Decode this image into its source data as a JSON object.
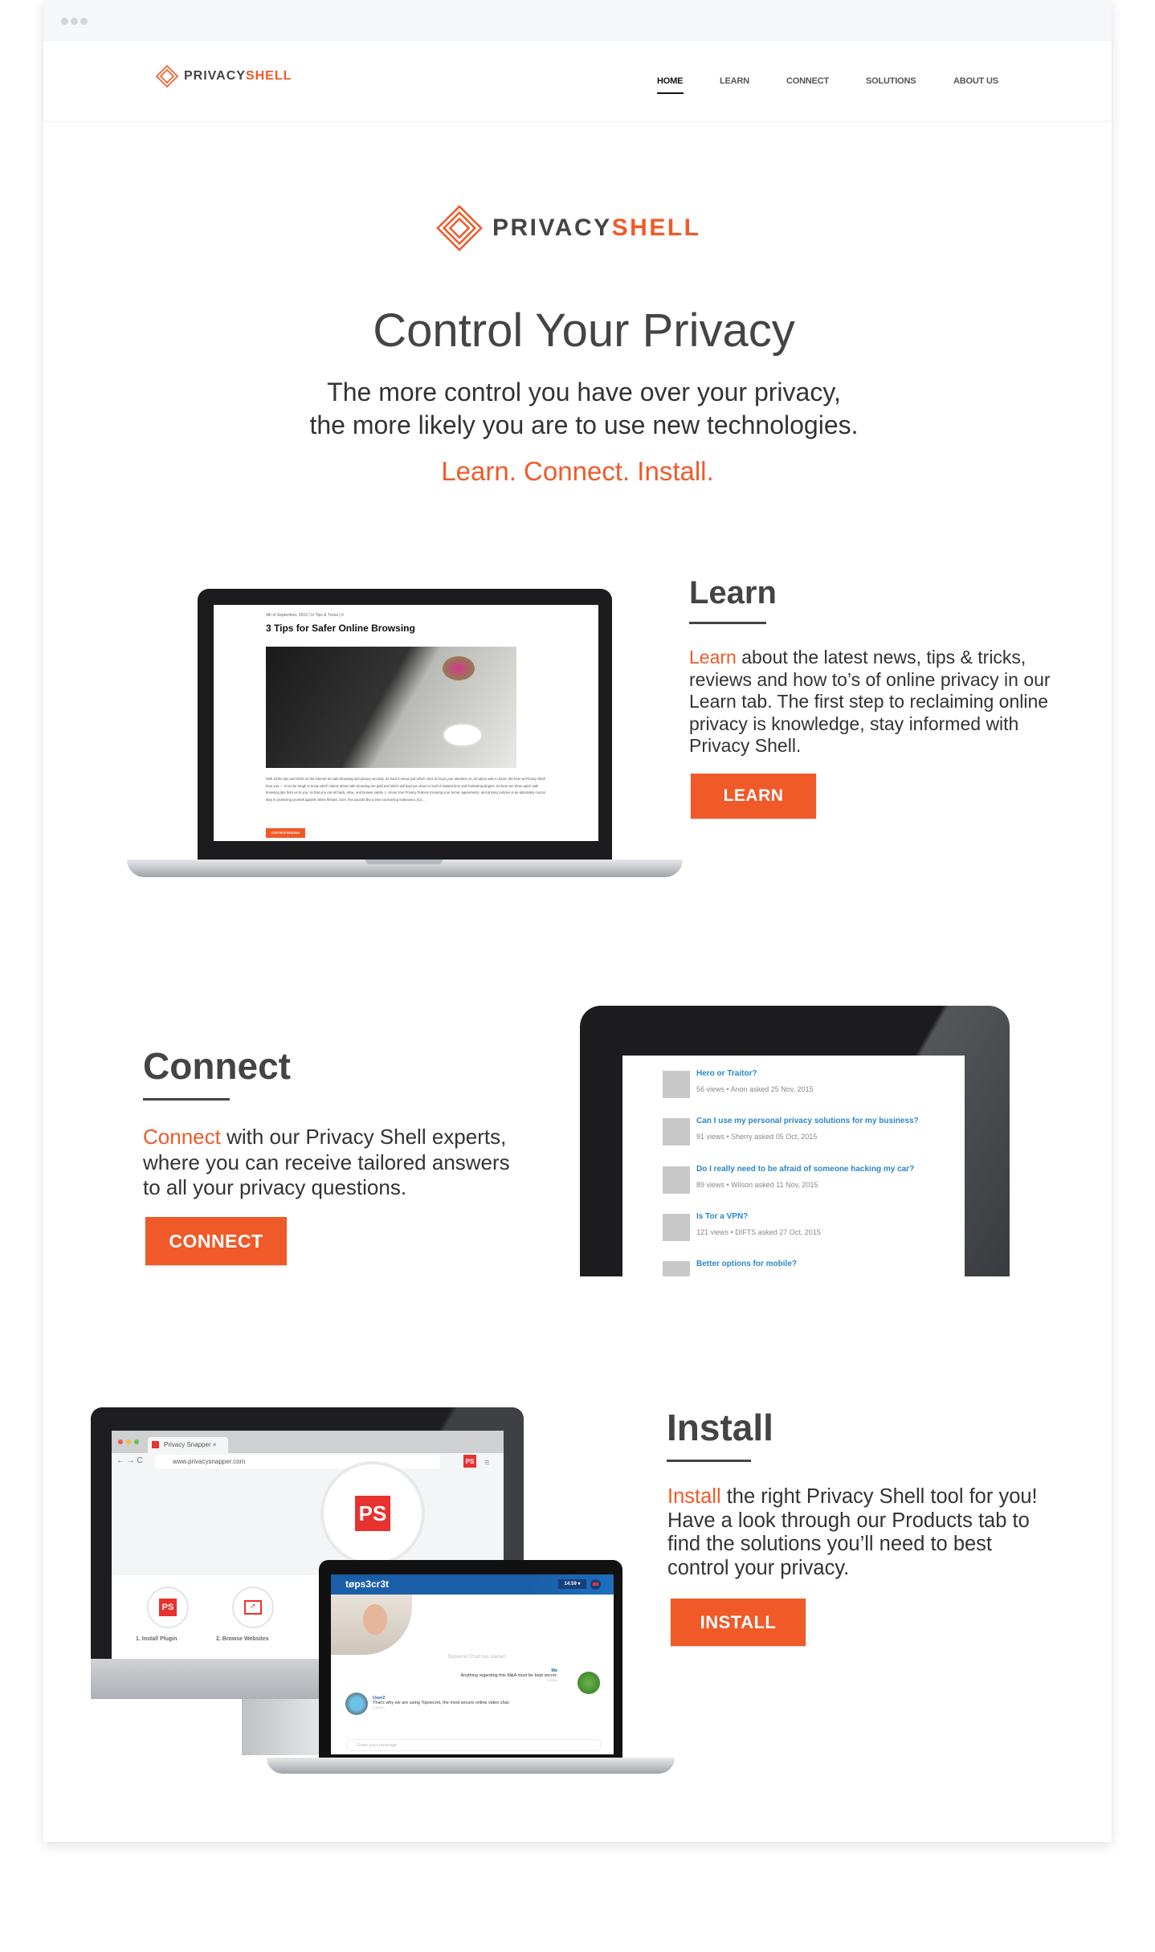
{
  "nav": {
    "brand_a": "PRIVACY",
    "brand_b": "SHELL",
    "items": [
      "HOME",
      "LEARN",
      "CONNECT",
      "SOLUTIONS",
      "ABOUT US"
    ],
    "active": "HOME"
  },
  "hero": {
    "brand_a": "PRIVACY",
    "brand_b": "SHELL",
    "title": "Control Your Privacy",
    "line1": "The more control you have over your privacy,",
    "line2": "the more likely you are to use new technologies.",
    "tagline": "Learn. Connect. Install."
  },
  "learn": {
    "heading": "Learn",
    "lead": "Learn",
    "text": " about the latest news, tips & tricks, reviews and how to’s of online privacy in our Learn tab. The first step to reclaiming online privacy is knowledge, stay informed with Privacy Shell.",
    "button": "LEARN",
    "article": {
      "meta": "9th of September, 2015  |  In Tips & Tricks  |  0",
      "title": "3 Tips for Safer Online Browsing",
      "body": "With all the tips and tricks on the internet for safe browsing and privacy security, it's hard to know just which ones to focus your attention on, let alone take to heart. We here at Privacy Shell hear you — it can be tough to know which claims about safe browsing are gold and which will lead you down a road of wasted time and frustrating plugins. So here are three quick safe browsing tips from us to you, so that you can sit back, relax, and browse safely. 1. Know Your Privacy Policies Knowing your terms, agreements, and privacy policies is an absolutely crucial step in protecting yourself against online threats. Sure, this sounds like a time-consuming endeavour, but ...",
      "button": "CONTINUE READING"
    }
  },
  "connect": {
    "heading": "Connect",
    "lead": "Connect",
    "text": " with our Privacy Shell experts, where you can receive tailored answers to all your privacy questions.",
    "button": "CONNECT",
    "questions": [
      {
        "title": "Hero or Traitor?",
        "views": "56 views",
        "asked": "Anon asked 25 Nov, 2015"
      },
      {
        "title": "Can I use my personal privacy solutions for my business?",
        "views": "91 views",
        "asked": "Sherry asked 05 Oct, 2015"
      },
      {
        "title": "Do I really need to be afraid of someone hacking my car?",
        "views": "89 views",
        "asked": "Wilson asked 11 Nov, 2015"
      },
      {
        "title": "Is Tor a VPN?",
        "views": "121 views",
        "asked": "DIFTS asked 27 Oct, 2015"
      },
      {
        "title": "Better options for mobile?",
        "views": "",
        "asked": ""
      }
    ]
  },
  "install": {
    "heading": "Install",
    "lead": "Install",
    "text": " the right Privacy Shell tool for you! Have a look through our Products tab to find the solutions you’ll need to best control your privacy.",
    "button": "INSTALL",
    "browser": {
      "tab": "Privacy Snapper",
      "url": "www.privacysnapper.com",
      "ps": "PS",
      "step1": "1. Install Plugin",
      "step2": "2. Browse Websites"
    },
    "chat": {
      "app": "tøps3cr3t",
      "time": "14:59 ▾",
      "started": "Topsecret Chat has started",
      "me": "Me",
      "me_msg": "Anything regarding this M&A must be kept secret.",
      "me_time": "3:59pm",
      "user": "User2",
      "user_msg": "That's why we are using Topsecret, the most secure online video chat.",
      "user_time": "3:59pm",
      "placeholder": "Enter your message"
    }
  },
  "colors": {
    "accent": "#f05a28",
    "link": "#2b87c4",
    "chat_header": "#1a5ea8",
    "ps_red": "#e8322f"
  }
}
